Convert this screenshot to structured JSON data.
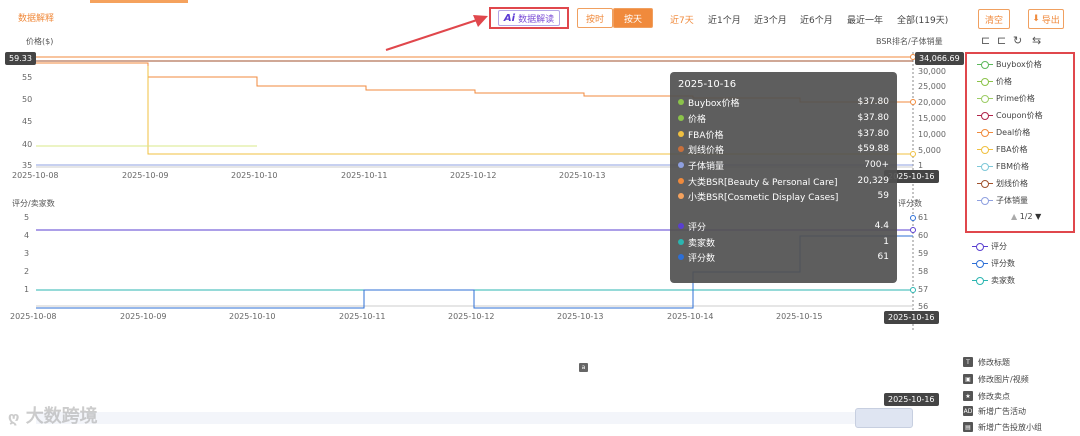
{
  "header": {
    "tab_label": "数据解释",
    "ai_badge": "Ai",
    "ai_label": "数据解读",
    "mode_hour": "按时",
    "mode_day": "按天",
    "ranges": [
      "近7天",
      "近1个月",
      "近3个月",
      "近6个月",
      "最近一年",
      "全部(119天)"
    ],
    "clear": "清空",
    "export": "导出"
  },
  "top_chart": {
    "left_axis_label": "价格($)",
    "right_axis_label": "BSR排名/子体销量",
    "left_ticks": [
      "55",
      "50",
      "45",
      "40",
      "35"
    ],
    "right_ticks": [
      "30,000",
      "25,000",
      "20,000",
      "15,000",
      "10,000",
      "5,000",
      "1"
    ],
    "price_marker": "59.33",
    "bsr_marker": "34,066.69",
    "dates": [
      "2025-10-08",
      "2025-10-09",
      "2025-10-10",
      "2025-10-11",
      "2025-10-12",
      "2025-10-13"
    ],
    "date_highlight": "2025-10-16"
  },
  "bottom_chart": {
    "left_axis_label": "评分/卖家数",
    "right_axis_label": "评分数",
    "left_ticks": [
      "5",
      "4",
      "3",
      "2",
      "1"
    ],
    "right_ticks": [
      "61",
      "60",
      "59",
      "58",
      "57",
      "56"
    ],
    "dates": [
      "2025-10-08",
      "2025-10-09",
      "2025-10-10",
      "2025-10-11",
      "2025-10-12",
      "2025-10-13",
      "2025-10-14",
      "2025-10-15"
    ],
    "date_highlight": "2025-10-16"
  },
  "tooltip": {
    "date": "2025-10-16",
    "rows": [
      {
        "label": "Buybox价格",
        "value": "$37.80",
        "color": "#8bc34a"
      },
      {
        "label": "价格",
        "value": "$37.80",
        "color": "#8bc34a"
      },
      {
        "label": "FBA价格",
        "value": "$37.80",
        "color": "#f0c040"
      },
      {
        "label": "划线价格",
        "value": "$59.88",
        "color": "#c8703c"
      },
      {
        "label": "子体销量",
        "value": "700+",
        "color": "#8fa0e0"
      },
      {
        "label": "大类BSR[Beauty & Personal Care]",
        "value": "20,329",
        "color": "#f08a3c"
      },
      {
        "label": "小类BSR[Cosmetic Display Cases]",
        "value": "59",
        "color": "#f5a25d"
      },
      {
        "label": "评分",
        "value": "4.4",
        "color": "#5a3fd0"
      },
      {
        "label": "卖家数",
        "value": "1",
        "color": "#2bb5b0"
      },
      {
        "label": "评分数",
        "value": "61",
        "color": "#2d6fd6"
      }
    ]
  },
  "legend": {
    "items": [
      {
        "label": "Buybox价格",
        "color": "#5cb85c"
      },
      {
        "label": "价格",
        "color": "#8bc34a"
      },
      {
        "label": "Prime价格",
        "color": "#9ccc65"
      },
      {
        "label": "Coupon价格",
        "color": "#b0254a"
      },
      {
        "label": "Deal价格",
        "color": "#f08a3c"
      },
      {
        "label": "FBA价格",
        "color": "#f0c040"
      },
      {
        "label": "FBM价格",
        "color": "#7ec8d8"
      },
      {
        "label": "划线价格",
        "color": "#a0522d"
      },
      {
        "label": "子体销量",
        "color": "#8fa0e0"
      }
    ],
    "pager": "1/2"
  },
  "legend_bottom": [
    {
      "label": "评分",
      "color": "#5a3fd0"
    },
    {
      "label": "评分数",
      "color": "#2d6fd6"
    },
    {
      "label": "卖家数",
      "color": "#2bb5b0"
    }
  ],
  "side_actions": [
    {
      "label": "修改标题",
      "icon": "T"
    },
    {
      "label": "修改图片/视频",
      "icon": "▣"
    },
    {
      "label": "修改卖点",
      "icon": "★"
    },
    {
      "label": "新增广告活动",
      "icon": "AD"
    },
    {
      "label": "新增广告投放小组",
      "icon": "▤"
    }
  ],
  "scroll_date": "2025-10-16",
  "watermark": "大数跨境",
  "colors": {
    "accent": "#f08a3c",
    "highlight_red": "#e0474c"
  }
}
